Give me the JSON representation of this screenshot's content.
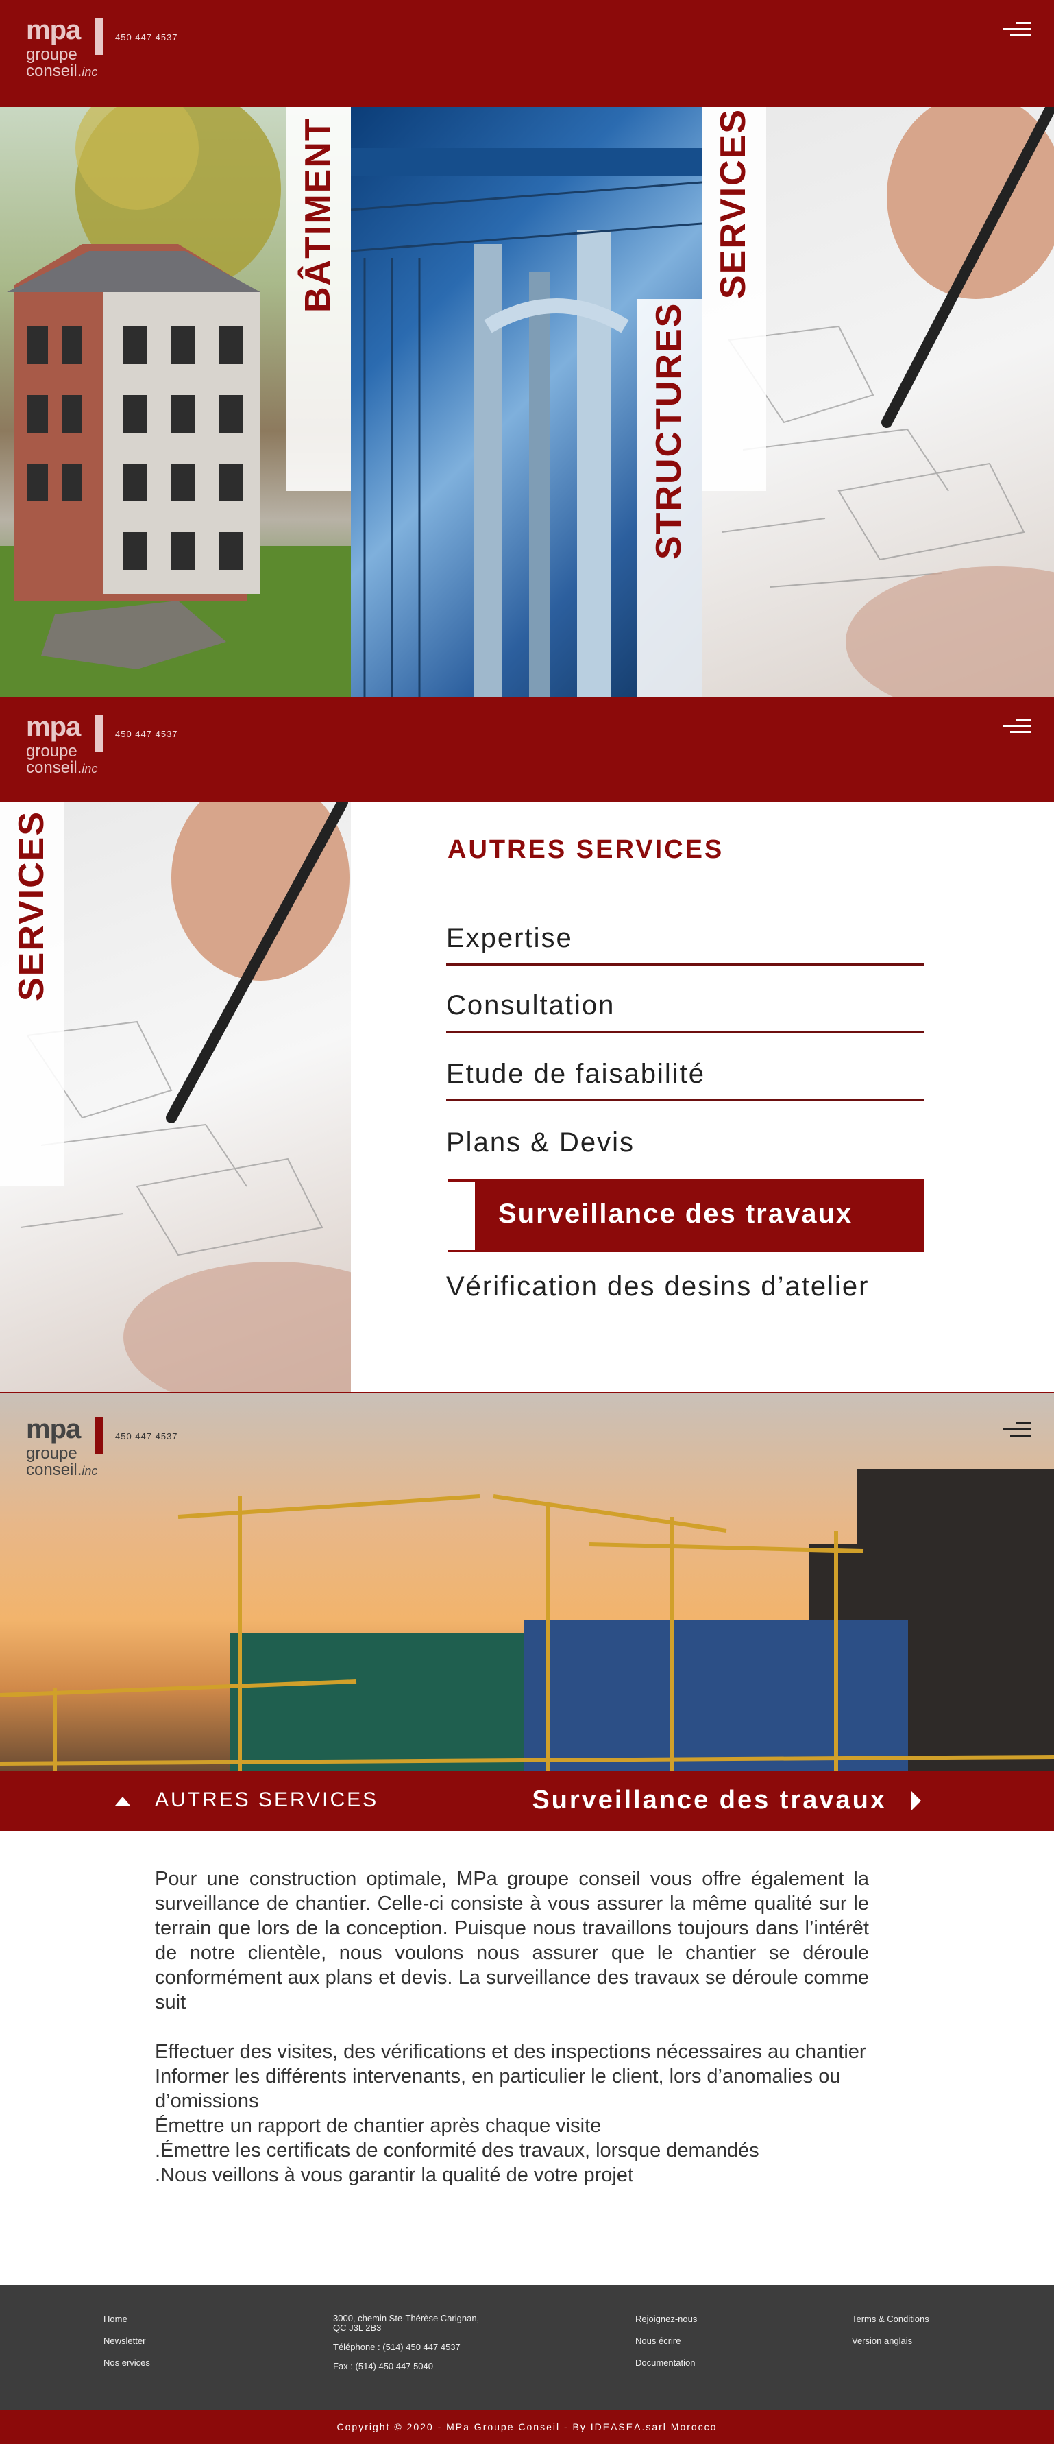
{
  "header": {
    "logo_mpa": "mpa",
    "logo_groupe": "groupe",
    "logo_conseil": "conseil.",
    "logo_inc": "inc",
    "phone": "450 447 4537"
  },
  "hero": {
    "panels": [
      {
        "label": "BÂTIMENT"
      },
      {
        "label": "STRUCTURES"
      },
      {
        "label": "SERVICES"
      }
    ]
  },
  "services": {
    "side_label": "SERVICES",
    "title": "AUTRES SERVICES",
    "items": [
      "Expertise",
      "Consultation",
      "Etude de faisabilité",
      "Plans & Devis",
      "Surveillance des travaux",
      "Vérification des desins d’atelier"
    ]
  },
  "detail": {
    "back_label": "AUTRES SERVICES",
    "current_label": "Surveillance des travaux",
    "paragraph": "Pour une construction optimale, MPa groupe conseil vous offre également la surveillance de chantier. Celle-ci consiste à vous assurer la même qualité sur le terrain que lors de la conception. Puisque nous travaillons toujours dans l’intérêt de notre clientèle, nous voulons nous assurer que le chantier se déroule conformément aux plans et devis. La surveillance des travaux se déroule comme suit",
    "list": [
      "Effectuer des visites, des vérifications et des inspections nécessaires au chantier",
      "Informer les différents intervenants, en particulier le client, lors d’anomalies ou d’omissions",
      "Émettre un rapport de chantier après chaque visite",
      ".Émettre les certificats de conformité des travaux, lorsque demandés",
      ".Nous veillons à vous garantir la qualité de votre projet"
    ]
  },
  "footer": {
    "col1": [
      "Home",
      "Newsletter",
      "Nos ervices"
    ],
    "address_line1": "3000, chemin Ste-Thérèse Carignan,",
    "address_line2": "QC J3L 2B3",
    "telephone": "Téléphone : (514) 450 447 4537",
    "fax": "Fax : (514) 450 447 5040",
    "col3": [
      "Rejoignez-nous",
      "Nous écrire",
      "Documentation"
    ],
    "col4": [
      "Terms & Conditions",
      "Version anglais"
    ],
    "copyright": "Copyright © 2020 - MPa Groupe Conseil - By IDEASEA.sarl Morocco"
  },
  "colors": {
    "brand_red": "#8c0a0a",
    "footer_gray": "#3d3d3d"
  }
}
